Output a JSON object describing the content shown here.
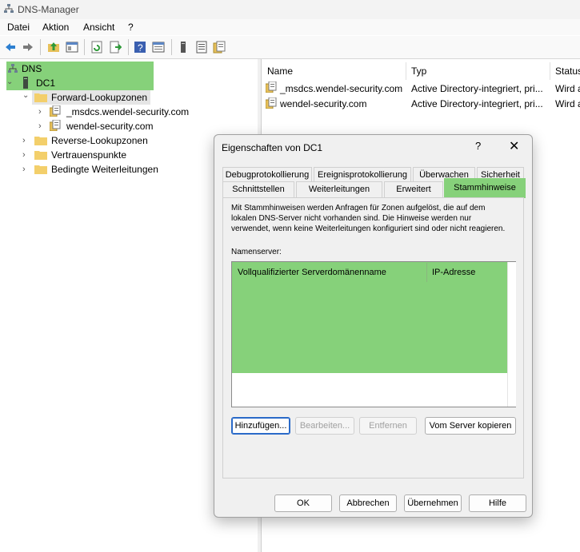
{
  "window": {
    "title": "DNS-Manager",
    "icon": "dns-manager-icon"
  },
  "menu": {
    "items": [
      "Datei",
      "Aktion",
      "Ansicht",
      "?"
    ]
  },
  "toolbar": {
    "icons": [
      "back-icon",
      "forward-icon",
      "up-folder-icon",
      "show-hide-tree-icon",
      "refresh-icon",
      "export-list-icon",
      "help-icon",
      "properties-icon",
      "server-icon",
      "list-icon",
      "zone-icon"
    ]
  },
  "tree": {
    "root": "DNS",
    "server": "DC1",
    "forward": "Forward-Lookupzonen",
    "zones": [
      "_msdcs.wendel-security.com",
      "wendel-security.com"
    ],
    "reverse": "Reverse-Lookupzonen",
    "trust": "Vertrauenspunkte",
    "conditional": "Bedingte Weiterleitungen"
  },
  "list": {
    "columns": [
      "Name",
      "Typ",
      "Status"
    ],
    "rows": [
      {
        "name": "_msdcs.wendel-security.com",
        "type": "Active Directory-integriert, pri...",
        "status": "Wird a"
      },
      {
        "name": "wendel-security.com",
        "type": "Active Directory-integriert, pri...",
        "status": "Wird a"
      }
    ]
  },
  "dialog": {
    "title": "Eigenschaften von DC1",
    "help": "?",
    "close": "✕",
    "tabs_row1": [
      "Debugprotokollierung",
      "Ereignisprotokollierung",
      "Überwachen",
      "Sicherheit"
    ],
    "tabs_row2": [
      "Schnittstellen",
      "Weiterleitungen",
      "Erweitert",
      "Stammhinweise"
    ],
    "active_tab": "Stammhinweise",
    "description": "Mit Stammhinweisen werden Anfragen für Zonen aufgelöst, die auf dem lokalen DNS-Server nicht vorhanden sind. Die Hinweise werden nur verwendet, wenn keine Weiterleitungen konfiguriert sind oder nicht reagieren.",
    "nameserver_label": "Namenserver:",
    "ns_columns": [
      "Vollqualifizierter Serverdomänenname",
      "IP-Adresse"
    ],
    "buttons": {
      "add": "Hinzufügen...",
      "edit": "Bearbeiten...",
      "remove": "Entfernen",
      "copy": "Vom Server kopieren"
    },
    "footer": {
      "ok": "OK",
      "cancel": "Abbrechen",
      "apply": "Übernehmen",
      "help": "Hilfe"
    }
  },
  "colors": {
    "highlight": "#86d17a"
  }
}
